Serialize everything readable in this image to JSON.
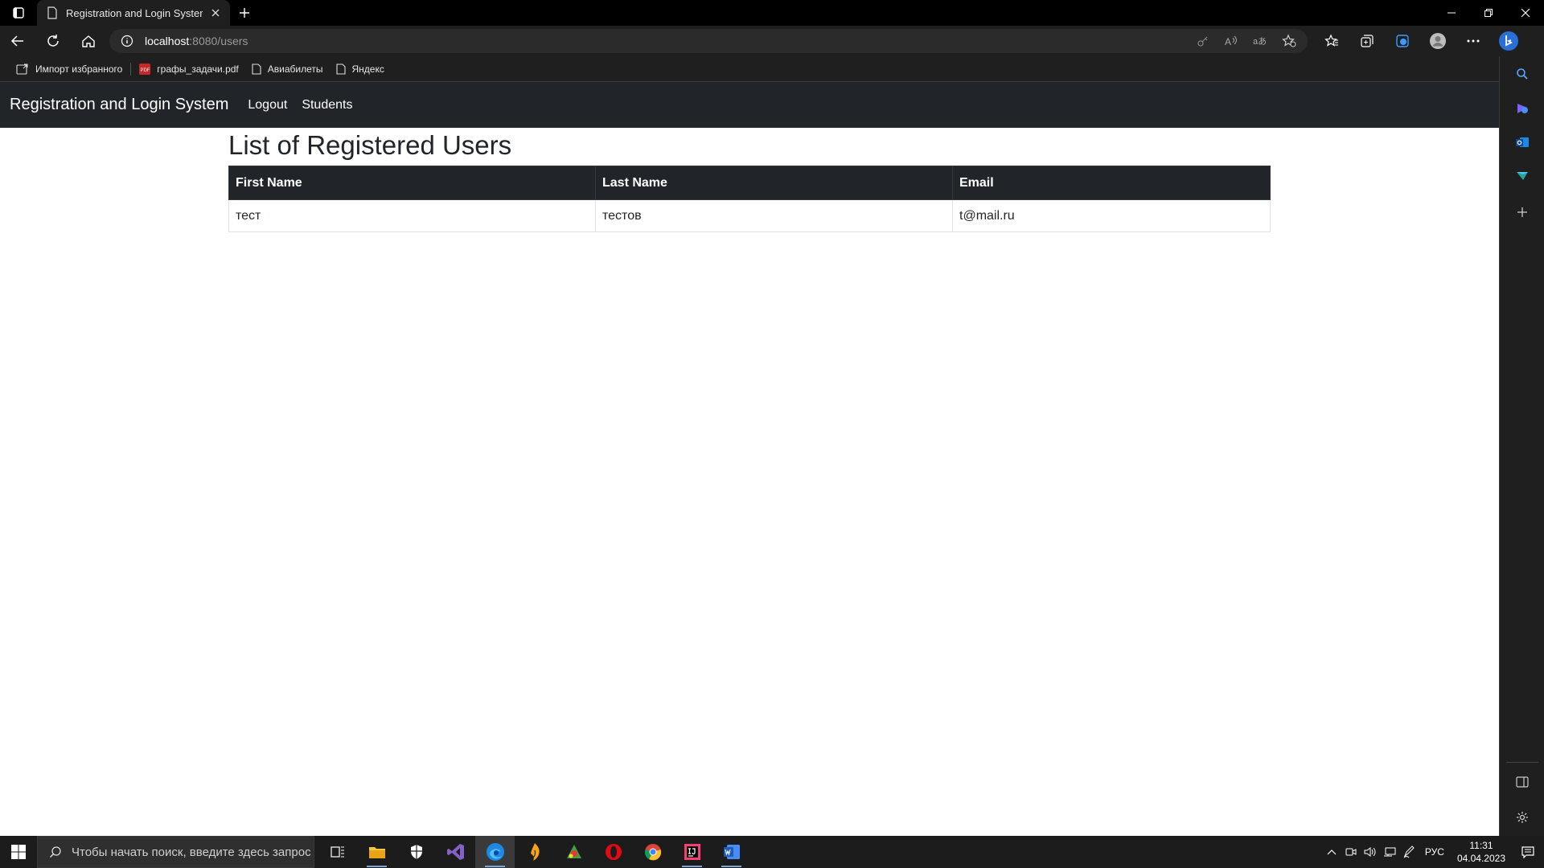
{
  "browser": {
    "tab_title": "Registration and Login System",
    "url_host": "localhost",
    "url_rest": ":8080/users",
    "bookmarks": [
      {
        "label": "Импорт избранного",
        "icon": "import-icon"
      },
      {
        "label": "графы_задачи.pdf",
        "icon": "pdf-icon"
      },
      {
        "label": "Авиабилеты",
        "icon": "page-icon"
      },
      {
        "label": "Яндекс",
        "icon": "page-icon"
      }
    ]
  },
  "site": {
    "brand": "Registration and Login System",
    "nav": {
      "logout": "Logout",
      "students": "Students"
    },
    "page_title": "List of Registered Users",
    "table": {
      "headers": [
        "First Name",
        "Last Name",
        "Email"
      ],
      "rows": [
        [
          "тест",
          "тестов",
          "t@mail.ru"
        ]
      ]
    }
  },
  "taskbar": {
    "search_placeholder": "Чтобы начать поиск, введите здесь запрос",
    "language": "РУС",
    "time": "11:31",
    "date": "04.04.2023"
  },
  "colors": {
    "navbar_bg": "#212529",
    "browser_chrome": "#1f1f1f",
    "taskbar_bg": "#1c1c1c"
  }
}
